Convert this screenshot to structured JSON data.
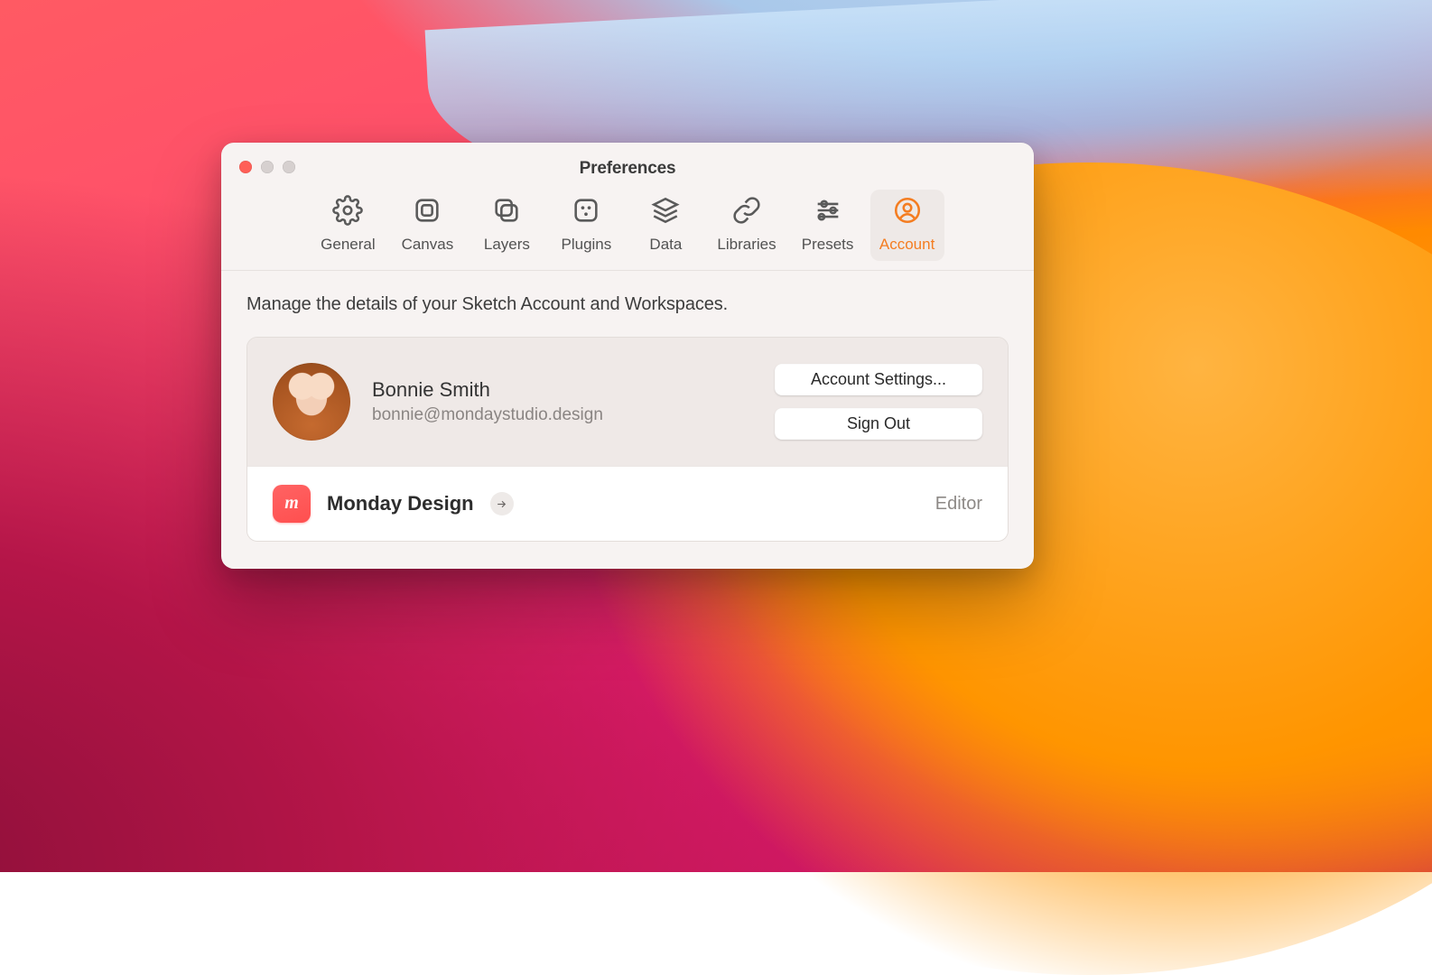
{
  "window": {
    "title": "Preferences"
  },
  "toolbar": {
    "items": [
      {
        "id": "general",
        "label": "General"
      },
      {
        "id": "canvas",
        "label": "Canvas"
      },
      {
        "id": "layers",
        "label": "Layers"
      },
      {
        "id": "plugins",
        "label": "Plugins"
      },
      {
        "id": "data",
        "label": "Data"
      },
      {
        "id": "libraries",
        "label": "Libraries"
      },
      {
        "id": "presets",
        "label": "Presets"
      },
      {
        "id": "account",
        "label": "Account"
      }
    ],
    "active": "account"
  },
  "content": {
    "description": "Manage the details of your Sketch Account and Workspaces."
  },
  "user": {
    "name": "Bonnie Smith",
    "email": "bonnie@mondaystudio.design"
  },
  "buttons": {
    "account_settings": "Account Settings...",
    "sign_out": "Sign Out"
  },
  "workspaces": [
    {
      "name": "Monday Design",
      "role": "Editor",
      "badge_letter": "m"
    }
  ],
  "colors": {
    "accent": "#f47d21",
    "workspace_icon": "#ff4f4f"
  }
}
